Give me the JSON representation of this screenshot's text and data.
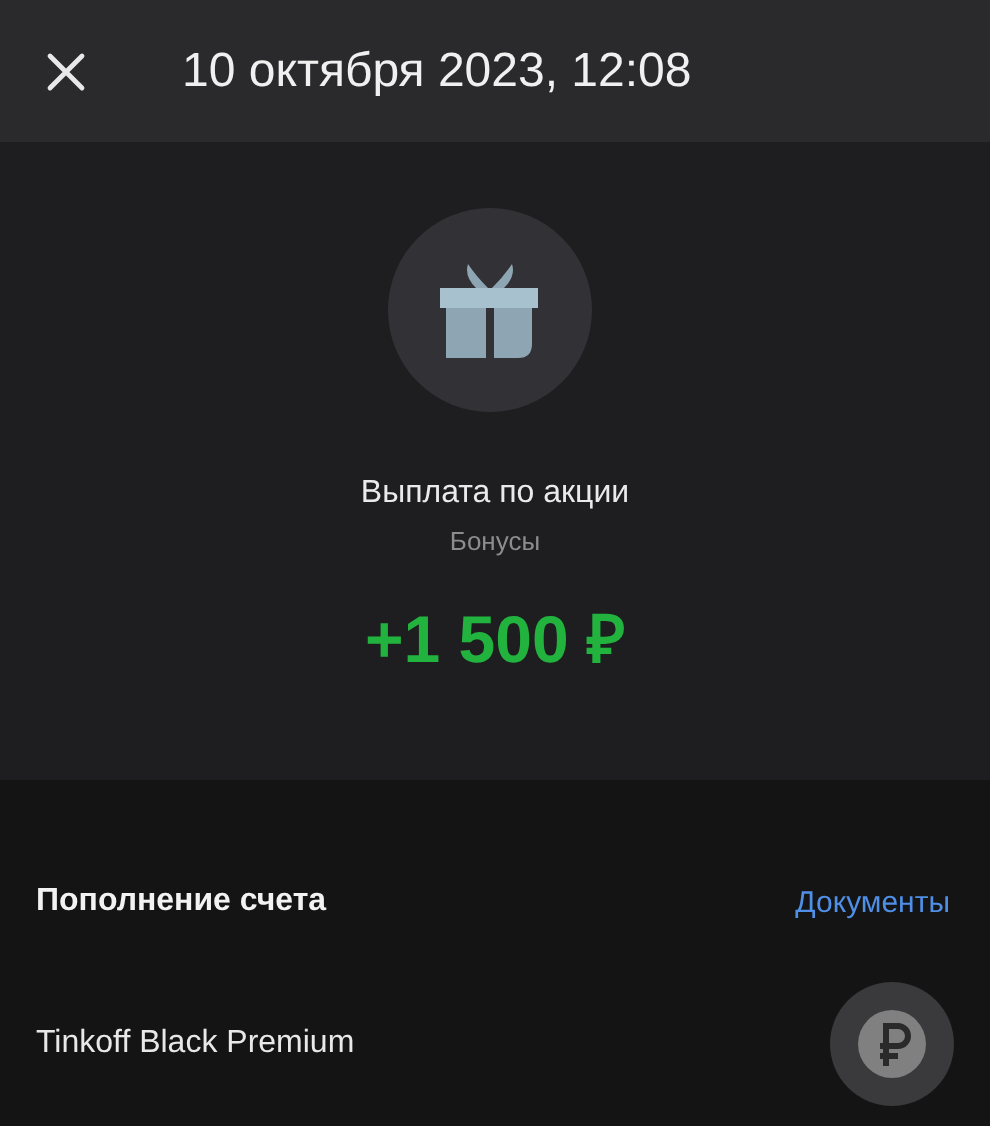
{
  "header": {
    "title": "10 октября 2023, 12:08"
  },
  "operation": {
    "title": "Выплата по акции",
    "category": "Бонусы",
    "amount": "+1 500 ₽"
  },
  "details": {
    "heading": "Пополнение счета",
    "link": "Документы",
    "account": "Tinkoff Black Premium"
  }
}
